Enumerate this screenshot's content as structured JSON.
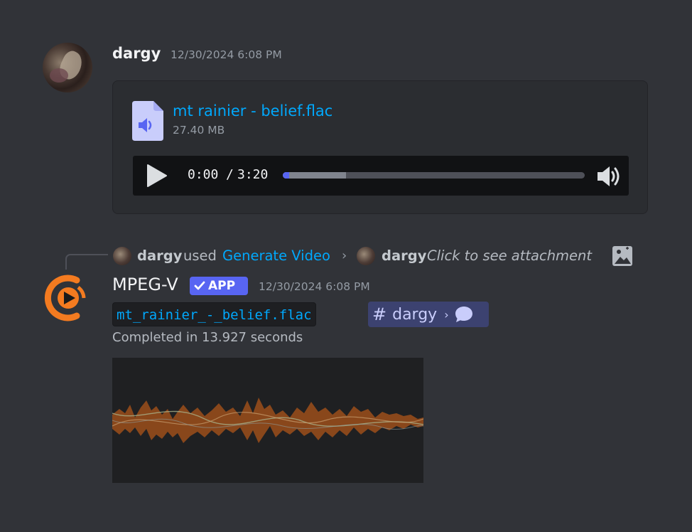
{
  "message1": {
    "username": "dargy",
    "timestamp": "12/30/2024 6:08 PM",
    "attachment": {
      "file_name": "mt rainier - belief.flac",
      "file_size": "27.40 MB",
      "player": {
        "current_time": "0:00",
        "separator": "/",
        "duration": "3:20",
        "progress_fraction": 0.0,
        "buffered_fraction": 0.21
      }
    }
  },
  "reply": {
    "user": "dargy",
    "used_text": "used",
    "command": "Generate Video",
    "target_user": "dargy",
    "click_text": "Click to see attachment",
    "icon": "image-icon"
  },
  "message2": {
    "username": "MPEG-V",
    "badge": "APP",
    "timestamp": "12/30/2024 6:08 PM",
    "code_chip": "mt_rainier_-_belief.flac",
    "mention": {
      "channel": "dargy"
    },
    "completed_text": "Completed in 13.927 seconds"
  },
  "colors": {
    "background": "#313338",
    "link": "#00a8fc",
    "accent": "#5865f2",
    "mpegv_orange": "#f47b20"
  }
}
